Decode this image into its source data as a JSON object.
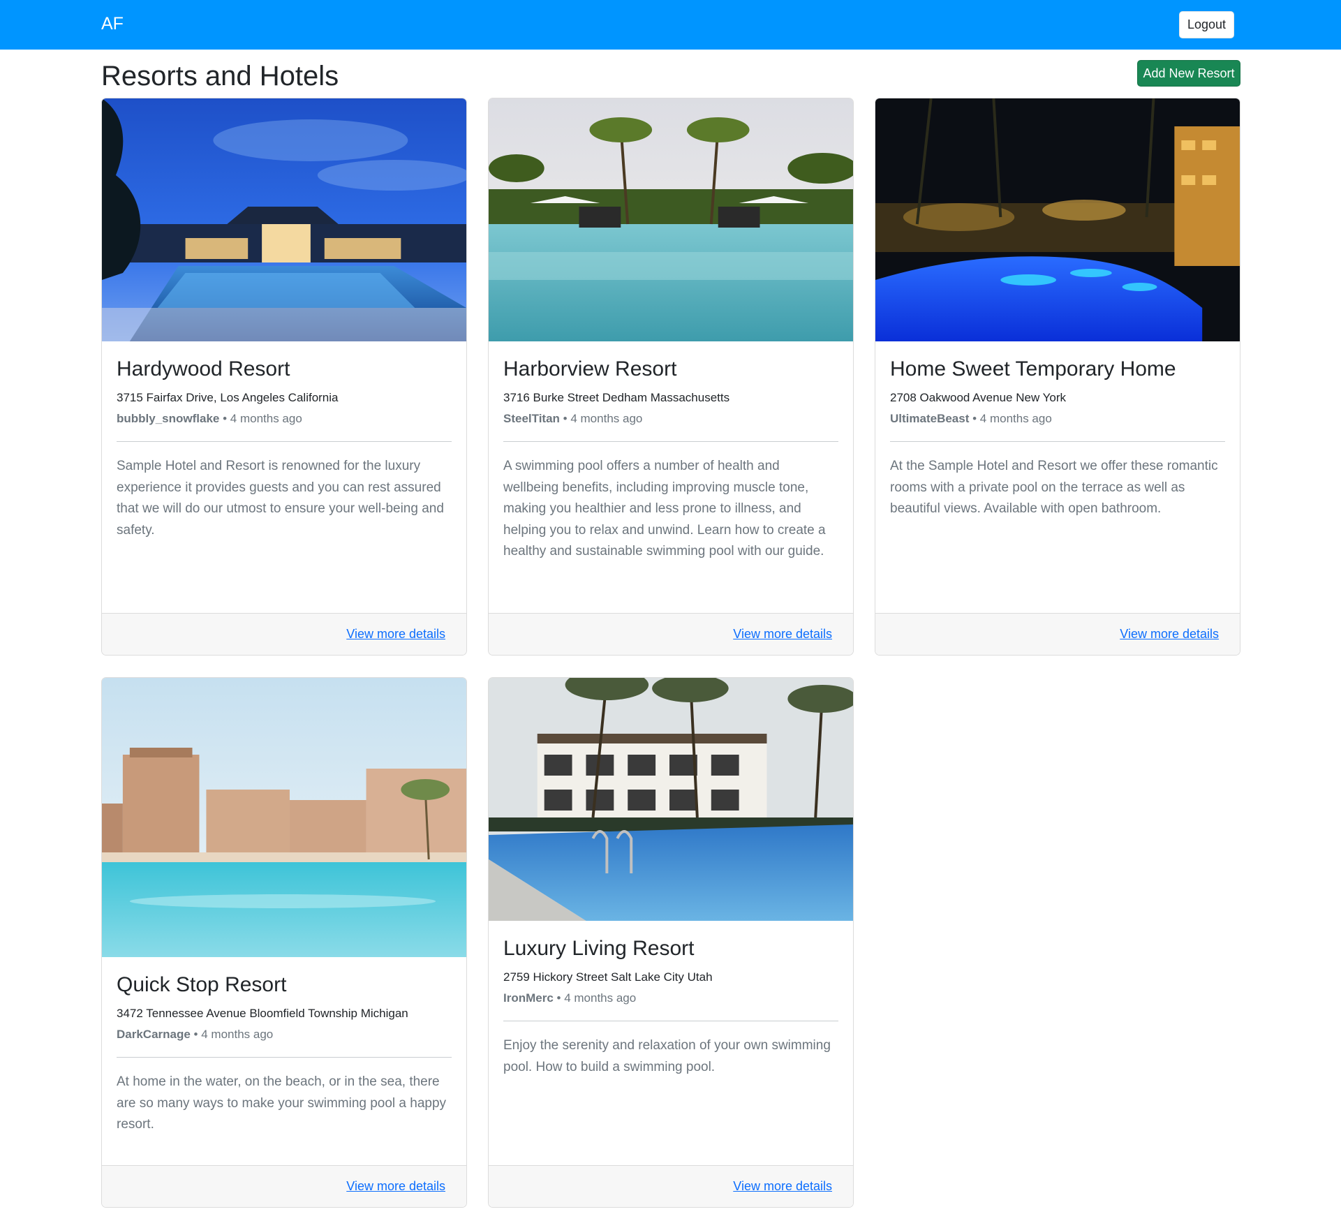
{
  "navbar": {
    "brand": "AF",
    "logout_label": "Logout"
  },
  "page": {
    "title": "Resorts and Hotels",
    "add_button_label": "Add New Resort"
  },
  "colors": {
    "navbar": "#0095ff",
    "add_button": "#198754",
    "link": "#0d6efd"
  },
  "resorts": [
    {
      "name": "Hardywood Resort",
      "address": "3715 Fairfax Drive, Los Angeles California",
      "author": "bubbly_snowflake",
      "time": "4 months ago",
      "description": "Sample Hotel and Resort is renowned for the luxury experience it provides guests and you can rest assured that we will do our utmost to ensure your well-being and safety.",
      "link": "View more details",
      "image": "resort at dusk with illuminated pool"
    },
    {
      "name": "Harborview Resort",
      "address": "3716 Burke Street Dedham Massachusetts",
      "author": "SteelTitan",
      "time": "4 months ago",
      "description": "A swimming pool offers a number of health and wellbeing benefits, including improving muscle tone, making you healthier and less prone to illness, and helping you to relax and unwind. Learn how to create a healthy and sustainable swimming pool with our guide.",
      "link": "View more details",
      "image": "infinity pool with palm trees"
    },
    {
      "name": "Home Sweet Temporary Home",
      "address": "2708 Oakwood Avenue New York",
      "author": "UltimateBeast",
      "time": "4 months ago",
      "description": "At the Sample Hotel and Resort we offer these romantic rooms with a private pool on the terrace as well as beautiful views. Available with open bathroom.",
      "link": "View more details",
      "image": "night pool lit blue with palms"
    },
    {
      "name": "Quick Stop Resort",
      "address": "3472 Tennessee Avenue Bloomfield Township Michigan",
      "author": "DarkCarnage",
      "time": "4 months ago",
      "description": "At home in the water, on the beach, or in the sea, there are so many ways to make your swimming pool a happy resort.",
      "link": "View more details",
      "image": "turquoise lagoon with sandstone buildings"
    },
    {
      "name": "Luxury Living Resort",
      "address": "2759 Hickory Street Salt Lake City Utah",
      "author": "IronMerc",
      "time": "4 months ago",
      "description": "Enjoy the serenity and relaxation of your own swimming pool. How to build a swimming pool.",
      "link": "View more details",
      "image": "pool with ladder in front of two-storey hotel"
    }
  ]
}
